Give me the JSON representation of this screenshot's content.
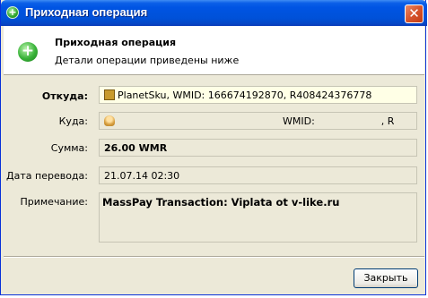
{
  "window": {
    "title": "Приходная операция",
    "close_glyph": "✕"
  },
  "header": {
    "title": "Приходная операция",
    "subtitle": "Детали операции приведены ниже"
  },
  "fields": {
    "from": {
      "label": "Откуда:",
      "value": "PlanetSku, WMID: 166674192870, R408424376778"
    },
    "to": {
      "label": "Куда:",
      "value_wmid": "WMID:",
      "value_purse": ", R"
    },
    "sum": {
      "label": "Сумма:",
      "value": "26.00 WMR"
    },
    "date": {
      "label": "Дата перевода:",
      "value": "21.07.14 02:30"
    },
    "note": {
      "label": "Примечание:",
      "value": "MassPay Transaction: Viplata ot v-like.ru"
    }
  },
  "buttons": {
    "close_label": "Закрыть"
  },
  "colors": {
    "titlebar": "#0054e3",
    "dialog_bg": "#ece9d8",
    "highlight_field": "#ffffe6"
  }
}
